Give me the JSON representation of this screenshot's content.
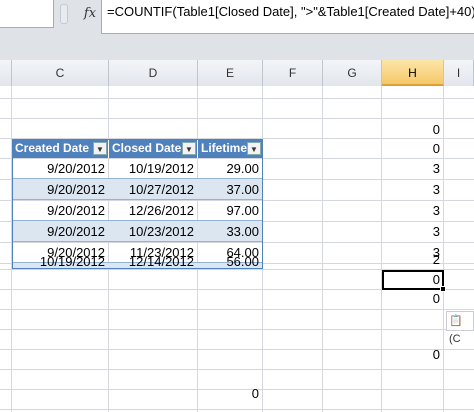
{
  "formula_bar": {
    "fx_label": "fx",
    "formula": "=COUNTIF(Table1[Closed Date], \">\"&Table1[Created Date]+40)"
  },
  "columns": [
    "C",
    "D",
    "E",
    "F",
    "G",
    "H",
    "I"
  ],
  "active_column": "H",
  "table": {
    "headers": [
      "Created Date",
      "Closed Date",
      "Lifetime"
    ],
    "rows": [
      [
        "9/20/2012",
        "10/19/2012",
        "29.00"
      ],
      [
        "9/20/2012",
        "10/27/2012",
        "37.00"
      ],
      [
        "9/20/2012",
        "12/26/2012",
        "97.00"
      ],
      [
        "9/20/2012",
        "10/23/2012",
        "33.00"
      ],
      [
        "9/20/2012",
        "11/23/2012",
        "64.00"
      ],
      [
        "10/19/2012",
        "12/14/2012",
        "56.00"
      ]
    ]
  },
  "column_h_values": [
    "0",
    "0",
    "3",
    "3",
    "3",
    "3",
    "3",
    "2",
    "0",
    "0",
    "0"
  ],
  "selected_cell_value": "0",
  "e_bottom_value": "0",
  "paste_options_label": "(C"
}
